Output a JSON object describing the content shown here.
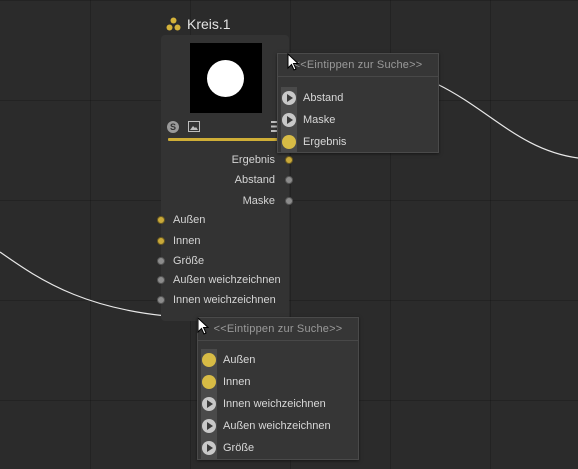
{
  "node": {
    "title": "Kreis.1",
    "icon": "node-cluster-icon",
    "progress": 1.0,
    "outputs": [
      {
        "label": "Ergebnis",
        "port": "yellow"
      },
      {
        "label": "Abstand",
        "port": "grey"
      },
      {
        "label": "Maske",
        "port": "grey"
      }
    ],
    "inputs": [
      {
        "label": "Außen",
        "port": "yellow"
      },
      {
        "label": "Innen",
        "port": "yellow"
      },
      {
        "label": "Größe",
        "port": "grey"
      },
      {
        "label": "Außen weichzeichnen",
        "port": "grey"
      },
      {
        "label": "Innen weichzeichnen",
        "port": "grey"
      }
    ]
  },
  "popup_top": {
    "search_placeholder": "<<Eintippen zur Suche>>",
    "items": [
      {
        "label": "Abstand",
        "icon": "play-icon"
      },
      {
        "label": "Maske",
        "icon": "play-icon"
      },
      {
        "label": "Ergebnis",
        "icon": "yellow-dot-icon"
      }
    ]
  },
  "popup_bottom": {
    "search_placeholder": "<<Eintippen zur Suche>>",
    "items": [
      {
        "label": "Außen",
        "icon": "yellow-dot-icon"
      },
      {
        "label": "Innen",
        "icon": "yellow-dot-icon"
      },
      {
        "label": "Innen weichzeichnen",
        "icon": "play-icon"
      },
      {
        "label": "Außen weichzeichnen",
        "icon": "play-icon"
      },
      {
        "label": "Größe",
        "icon": "play-icon"
      }
    ]
  },
  "colors": {
    "background": "#2b2b2b",
    "node_body": "#333333",
    "accent_yellow": "#cfae37",
    "port_grey": "#8c8c8c"
  }
}
